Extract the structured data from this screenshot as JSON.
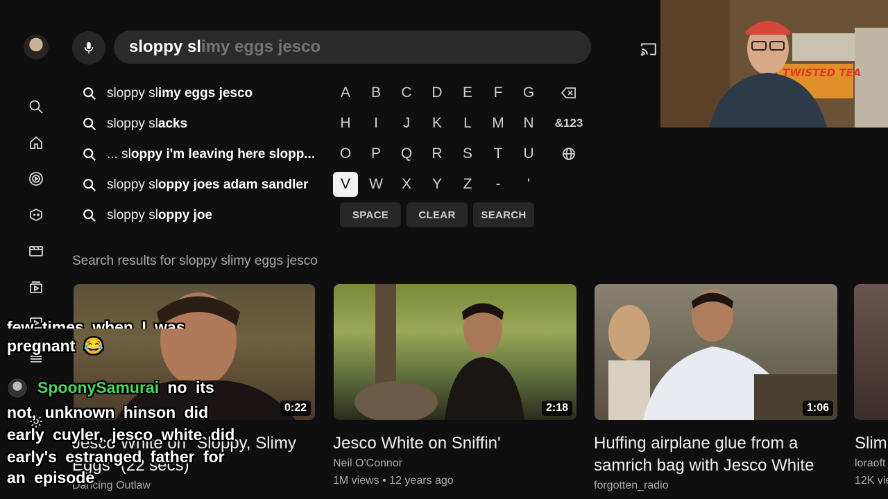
{
  "search": {
    "typed": "sloppy sl",
    "completion": "imy eggs jesco"
  },
  "suggestions": [
    {
      "pre": "sloppy sl",
      "post": "imy eggs jesco"
    },
    {
      "pre": "sloppy sl",
      "post": "acks"
    },
    {
      "pre": "... sl",
      "post": "oppy i'm leaving here slopp..."
    },
    {
      "pre": "sloppy sl",
      "post": "oppy joes adam sandler"
    },
    {
      "pre": "sloppy sl",
      "post": "oppy joe"
    }
  ],
  "keyboard": {
    "rows": [
      [
        "A",
        "B",
        "C",
        "D",
        "E",
        "F",
        "G"
      ],
      [
        "H",
        "I",
        "J",
        "K",
        "L",
        "M",
        "N"
      ],
      [
        "O",
        "P",
        "Q",
        "R",
        "S",
        "T",
        "U"
      ],
      [
        "V",
        "W",
        "X",
        "Y",
        "Z",
        "-",
        "'"
      ]
    ],
    "selected": "V",
    "symbols_label": "&123",
    "space_label": "SPACE",
    "clear_label": "CLEAR",
    "search_label": "SEARCH"
  },
  "results_label": "Search results for sloppy slimy eggs jesco",
  "videos": [
    {
      "title": "Jesco White on \"Sloppy, Slimy Eggs\" (22 secs)",
      "channel": "Dancing Outlaw",
      "meta": "",
      "duration": "0:22"
    },
    {
      "title": "Jesco White on Sniffin'",
      "channel": "Neil O'Connor",
      "meta": "1M views • 12 years ago",
      "duration": "2:18"
    },
    {
      "title": "Huffing airplane glue from a samrich bag with Jesco White",
      "channel": "forgotten_radio",
      "meta": "",
      "duration": "1:06"
    },
    {
      "title": "Slim",
      "channel": "loraoft",
      "meta": "12K vie",
      "duration": ""
    }
  ],
  "chat": {
    "line_top_a": "few times when I was",
    "line_top_b": "pregnant 😂",
    "username": "SpoonySamurai",
    "message_1": "no its",
    "message_2": "not, unknown hinson did",
    "message_3": "early cuyler, jesco white did",
    "message_4": "early's estranged father for",
    "message_5": "an episode"
  },
  "webcam": {
    "sign_text": "TWISTED TEA"
  },
  "icons": {
    "nav": [
      "search-icon",
      "home-icon",
      "subscriptions-icon",
      "gaming-icon",
      "movies-icon",
      "library-icon",
      "playlist-icon",
      "menu-icon",
      "settings-icon"
    ]
  }
}
